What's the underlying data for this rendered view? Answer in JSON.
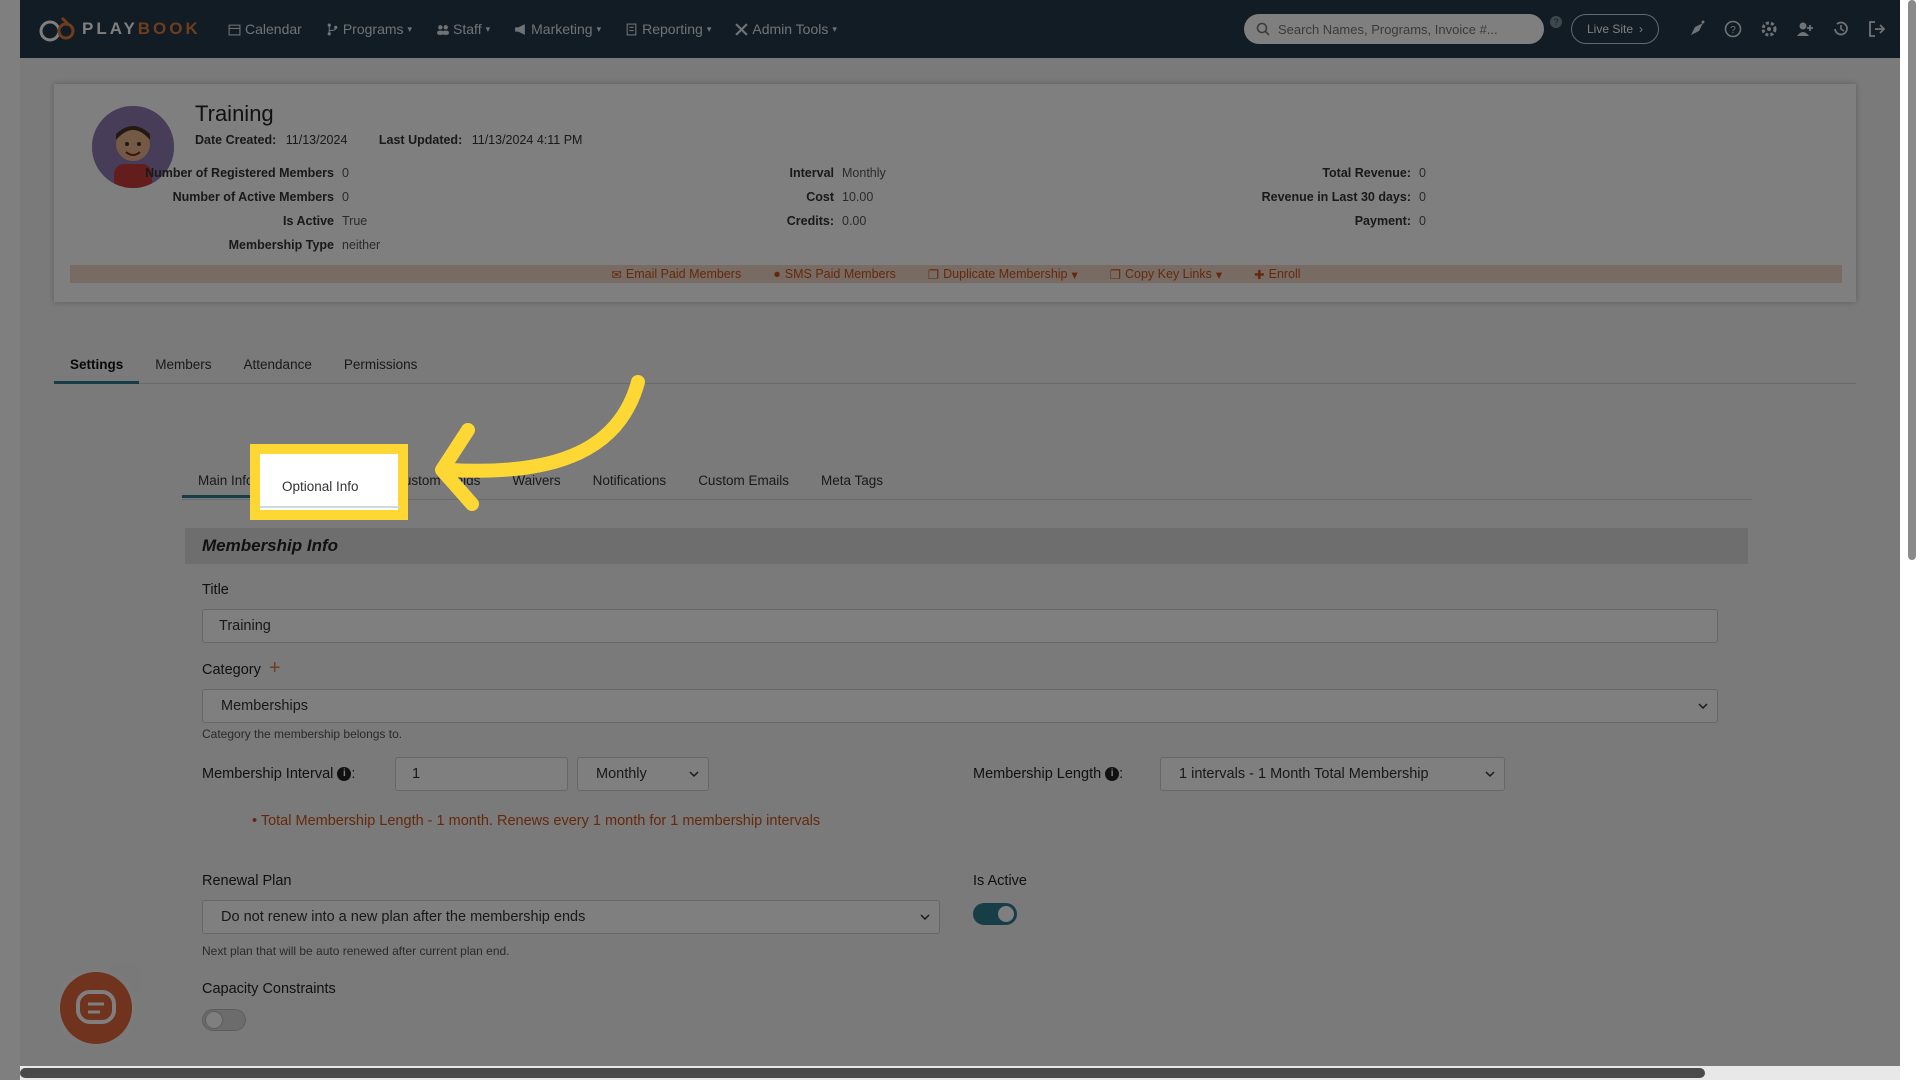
{
  "nav": {
    "logo_text": "PLAY",
    "logo_text2": "BOOK",
    "items": [
      {
        "label": "Calendar"
      },
      {
        "label": "Programs"
      },
      {
        "label": "Staff"
      },
      {
        "label": "Marketing"
      },
      {
        "label": "Reporting"
      },
      {
        "label": "Admin Tools"
      }
    ],
    "search_placeholder": "Search Names, Programs, Invoice #...",
    "live_site": "Live Site"
  },
  "program": {
    "title": "Training",
    "date_created_label": "Date Created:",
    "date_created": "11/13/2024",
    "last_updated_label": "Last Updated:",
    "last_updated": "11/13/2024 4:11 PM",
    "stats_left": [
      {
        "label": "Number of Registered Members",
        "value": "0"
      },
      {
        "label": "Number of Active Members",
        "value": "0"
      },
      {
        "label": "Is Active",
        "value": "True"
      },
      {
        "label": "Membership Type",
        "value": "neither"
      }
    ],
    "stats_mid": [
      {
        "label": "Interval",
        "value": "Monthly"
      },
      {
        "label": "Cost",
        "value": "10.00"
      },
      {
        "label": "Credits:",
        "value": "0.00"
      }
    ],
    "stats_right": [
      {
        "label": "Total Revenue:",
        "value": "0"
      },
      {
        "label": "Revenue in Last 30 days:",
        "value": "0"
      },
      {
        "label": "Payment:",
        "value": "0"
      }
    ],
    "actions": [
      {
        "label": "Email Paid Members"
      },
      {
        "label": "SMS Paid Members"
      },
      {
        "label": "Duplicate Membership"
      },
      {
        "label": "Copy Key Links"
      },
      {
        "label": "Enroll"
      }
    ]
  },
  "main_tabs": [
    {
      "label": "Settings"
    },
    {
      "label": "Members"
    },
    {
      "label": "Attendance"
    },
    {
      "label": "Permissions"
    }
  ],
  "sub_tabs": [
    {
      "label": "Main Info"
    },
    {
      "label": "Optional Info"
    },
    {
      "label": "Custom Fields"
    },
    {
      "label": "Waivers"
    },
    {
      "label": "Notifications"
    },
    {
      "label": "Custom Emails"
    },
    {
      "label": "Meta Tags"
    }
  ],
  "form": {
    "section_title": "Membership Info",
    "title_label": "Title",
    "title_value": "Training",
    "category_label": "Category",
    "category_value": "Memberships",
    "category_help": "Category the membership belongs to.",
    "interval_label": "Membership Interval",
    "interval_value": "1",
    "interval_unit": "Monthly",
    "length_label": "Membership Length",
    "length_value": "1 intervals - 1 Month Total Membership",
    "length_note": "Total Membership Length - 1 month. Renews every 1 month for 1 membership intervals",
    "renewal_label": "Renewal Plan",
    "renewal_value": "Do not renew into a new plan after the membership ends",
    "renewal_help": "Next plan that will be auto renewed after current plan end.",
    "active_label": "Is Active",
    "is_active": true,
    "capacity_label": "Capacity Constraints",
    "capacity_on": false
  },
  "colors": {
    "topbar": "#23394a",
    "accent": "#2f7c8f",
    "orange": "#e07b39",
    "highlight": "#fdd835"
  }
}
